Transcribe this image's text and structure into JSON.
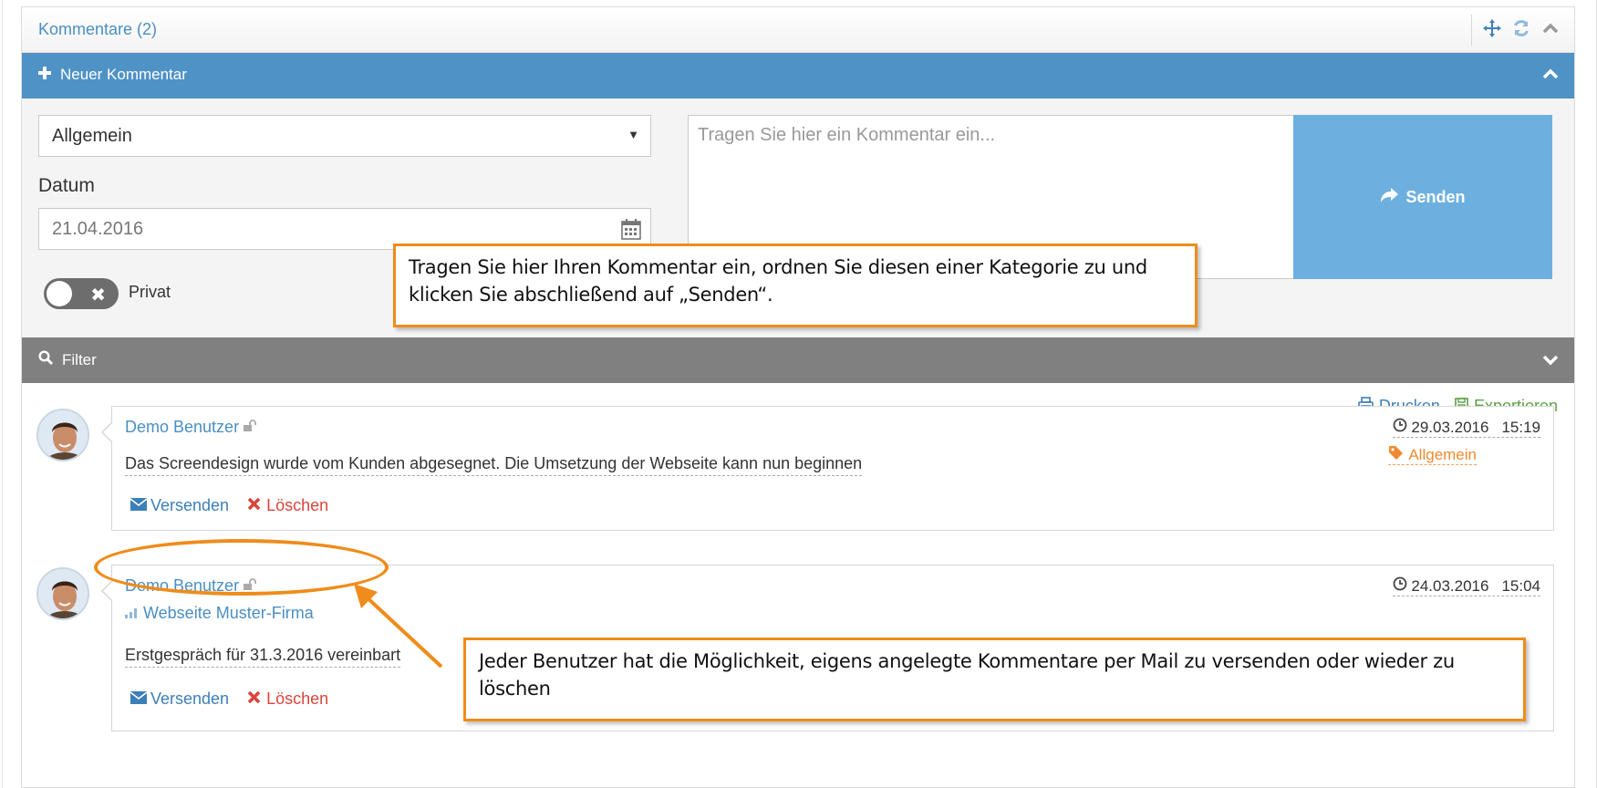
{
  "panel": {
    "title": "Kommentare (2)"
  },
  "new_comment": {
    "bar_label": "Neuer Kommentar",
    "category_selected": "Allgemein",
    "date_label": "Datum",
    "date_value": "21.04.2016",
    "private_label": "Privat",
    "textarea_placeholder": "Tragen Sie hier ein Kommentar ein...",
    "send_label": "Senden"
  },
  "filter": {
    "bar_label": "Filter"
  },
  "actions": {
    "print_label": "Drucken",
    "export_label": "Exportieren"
  },
  "comments": [
    {
      "author": "Demo Benutzer",
      "project": "",
      "text": "Das Screendesign wurde vom Kunden abgesegnet. Die Umsetzung der Webseite kann nun beginnen",
      "date": "29.03.2016",
      "time": "15:19",
      "category": "Allgemein",
      "send_label": "Versenden",
      "delete_label": "Löschen"
    },
    {
      "author": "Demo Benutzer",
      "project": "Webseite Muster-Firma",
      "text": "Erstgespräch für 31.3.2016 vereinbart",
      "date": "24.03.2016",
      "time": "15:04",
      "category": "",
      "send_label": "Versenden",
      "delete_label": "Löschen"
    }
  ],
  "annotations": {
    "callout_1": "Tragen Sie hier Ihren Kommentar ein, ordnen Sie diesen einer Kategorie zu und klicken Sie abschließend auf „Senden“.",
    "callout_2": "Jeder Benutzer hat die Möglichkeit, eigens angelegte Kommentare per Mail zu versenden oder wieder zu löschen"
  },
  "colors": {
    "accent_blue": "#4f92c6",
    "send_button": "#6db0e0",
    "filter_bar": "#808080",
    "annotation_orange": "#ef8c1b",
    "delete_red": "#d9453a",
    "export_green": "#5ba046",
    "category_orange": "#f08a30"
  },
  "icons": {
    "move": "move-icon",
    "refresh": "refresh-icon",
    "collapse": "chevron-up-icon",
    "plus": "plus-icon",
    "calendar": "calendar-icon",
    "share": "share-icon",
    "search": "search-icon",
    "expand": "chevron-down-icon",
    "print": "print-icon",
    "save": "save-icon",
    "lock": "unlock-icon",
    "clock": "clock-icon",
    "tag": "tag-icon",
    "envelope": "envelope-icon",
    "close": "x-icon",
    "signal": "signal-icon"
  }
}
